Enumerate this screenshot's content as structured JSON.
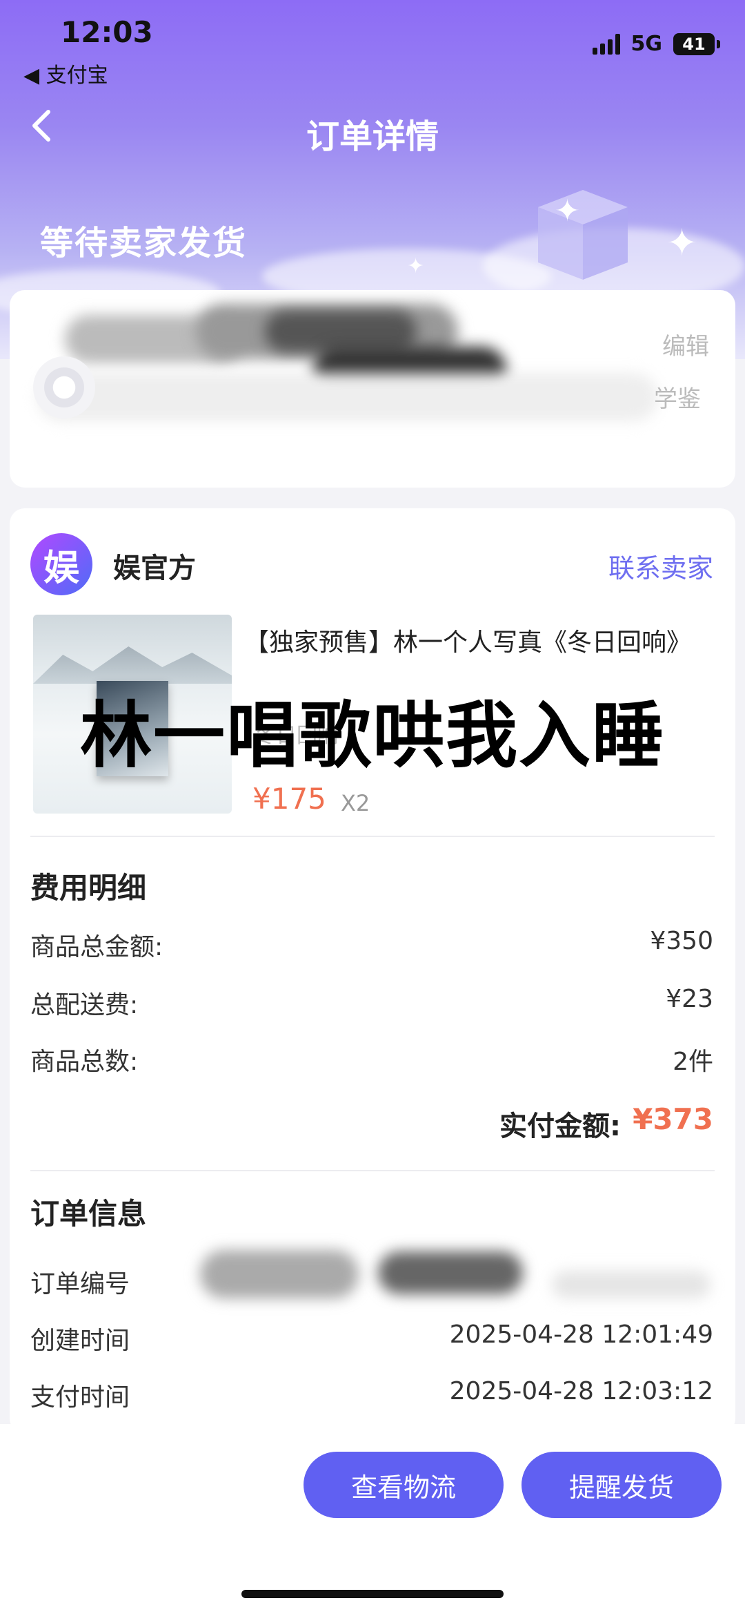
{
  "status_bar": {
    "time": "12:03",
    "back_app": "◀ 支付宝",
    "network": "5G",
    "battery": "41"
  },
  "nav": {
    "back_icon": "chevron-left-icon",
    "title": "订单详情"
  },
  "order_status": "等待卖家发货",
  "address": {
    "edit": "编辑",
    "learn": "学鉴"
  },
  "shop": {
    "logo_text": "娱",
    "name": "娱官方",
    "contact": "联系卖家"
  },
  "product": {
    "title": "【独家预售】林一个人写真《冬日回响》",
    "subtitle": "冬日回响",
    "price": "¥175",
    "quantity": "X2"
  },
  "overlay_text": "林一唱歌哄我入睡",
  "fees": {
    "title": "费用明细",
    "rows": [
      {
        "label": "商品总金额:",
        "value": "¥350"
      },
      {
        "label": "总配送费:",
        "value": "¥23"
      },
      {
        "label": "商品总数:",
        "value": "2件"
      }
    ],
    "total_label": "实付金额:",
    "total_value": "¥373"
  },
  "order_info": {
    "title": "订单信息",
    "rows": [
      {
        "label": "订单编号",
        "value": ""
      },
      {
        "label": "创建时间",
        "value": "2025-04-28 12:01:49"
      },
      {
        "label": "支付时间",
        "value": "2025-04-28 12:03:12"
      }
    ]
  },
  "actions": {
    "logistics": "查看物流",
    "remind": "提醒发货"
  },
  "colors": {
    "accent": "#6060f2",
    "price": "#f07050",
    "header_top": "#8d6cf5"
  }
}
